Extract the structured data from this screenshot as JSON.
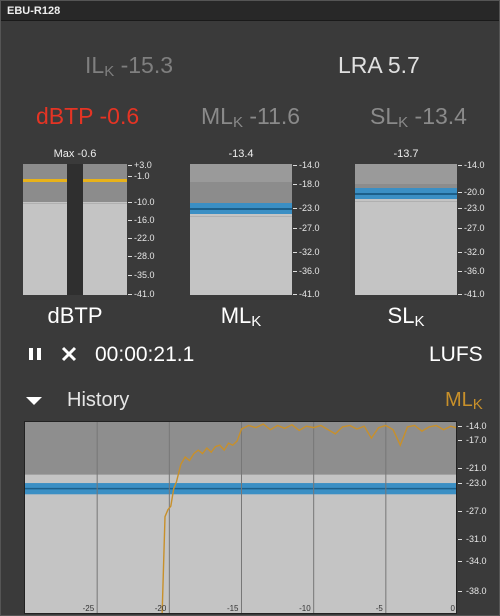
{
  "window": {
    "title": "EBU-R128"
  },
  "readouts": {
    "il": {
      "name": "IL",
      "sub": "K",
      "value": "-15.3"
    },
    "lra": {
      "name": "LRA",
      "value": "5.7"
    },
    "dbtp": {
      "name": "dBTP",
      "value": "-0.6",
      "color": "#e53424"
    },
    "ml": {
      "name": "ML",
      "sub": "K",
      "value": "-11.6"
    },
    "sl": {
      "name": "SL",
      "sub": "K",
      "value": "-13.4"
    }
  },
  "meters": {
    "dbtp": {
      "peak_label": "Max -0.6",
      "label": "dBTP",
      "scale": [
        "+3.0",
        "-1.0",
        "-10.0",
        "-16.0",
        "-22.0",
        "-28.0",
        "-35.0",
        "-41.0"
      ],
      "peak_hold_db": -0.6
    },
    "ml": {
      "peak_label": "-13.4",
      "label": "ML",
      "label_sub": "K",
      "scale": [
        "-14.0",
        "-18.0",
        "-23.0",
        "-27.0",
        "-32.0",
        "-36.0",
        "-41.0"
      ],
      "level_db": -11.6
    },
    "sl": {
      "peak_label": "-13.7",
      "label": "SL",
      "label_sub": "K",
      "scale": [
        "-14.0",
        "-20.0",
        "-23.0",
        "-27.0",
        "-32.0",
        "-36.0",
        "-41.0"
      ],
      "level_db": -13.4
    }
  },
  "transport": {
    "pause_icon": "pause-icon",
    "reset_icon": "close-icon",
    "time": "00:00:21.1",
    "unit": "LUFS"
  },
  "history": {
    "toggle_icon": "triangle-down-icon",
    "title": "History",
    "series_label": "ML",
    "series_label_sub": "K",
    "series_color": "#c8902a",
    "y_scale": [
      "-14.0",
      "-17.0",
      "-21.0",
      "-23.0",
      "-27.0",
      "-31.0",
      "-34.0",
      "-38.0"
    ],
    "x_ticks": [
      "-25",
      "-20",
      "-15",
      "-10",
      "-5",
      "0"
    ]
  },
  "chart_data": {
    "type": "line",
    "title": "History",
    "xlabel": "",
    "ylabel": "",
    "xlim": [
      -30,
      0
    ],
    "ylim": [
      -41,
      -13.5
    ],
    "series": [
      {
        "name": "ML",
        "x": [
          -20.5,
          -20.3,
          -20.1,
          -19.9,
          -19.7,
          -19.5,
          -19.2,
          -18.9,
          -18.6,
          -18.3,
          -18.0,
          -17.7,
          -17.4,
          -17.1,
          -16.8,
          -16.5,
          -16.2,
          -15.9,
          -15.6,
          -15.3,
          -15.0,
          -14.5,
          -14.0,
          -13.5,
          -13.0,
          -12.5,
          -12.0,
          -11.5,
          -11.0,
          -10.5,
          -10.0,
          -9.5,
          -9.0,
          -8.5,
          -8.0,
          -7.5,
          -7.0,
          -6.5,
          -6.0,
          -5.5,
          -5.0,
          -4.5,
          -4.0,
          -3.5,
          -3.0,
          -2.5,
          -2.0,
          -1.5,
          -1.0,
          -0.5,
          0.0
        ],
        "values": [
          -41.0,
          -27.0,
          -26.0,
          -25.5,
          -23.0,
          -22.0,
          -19.5,
          -18.5,
          -19.0,
          -18.0,
          -17.5,
          -18.0,
          -17.2,
          -17.8,
          -17.0,
          -16.8,
          -17.5,
          -16.5,
          -16.8,
          -16.2,
          -14.5,
          -14.0,
          -14.3,
          -13.8,
          -14.6,
          -14.0,
          -14.4,
          -13.9,
          -14.7,
          -14.1,
          -14.3,
          -14.0,
          -14.6,
          -15.2,
          -14.2,
          -14.0,
          -14.5,
          -14.1,
          -15.8,
          -14.3,
          -14.0,
          -14.6,
          -16.8,
          -14.2,
          -14.0,
          -14.8,
          -14.2,
          -14.0,
          -14.6,
          -14.1,
          -14.4
        ]
      }
    ],
    "target_band": [
      -23.8,
      -22.2
    ]
  }
}
